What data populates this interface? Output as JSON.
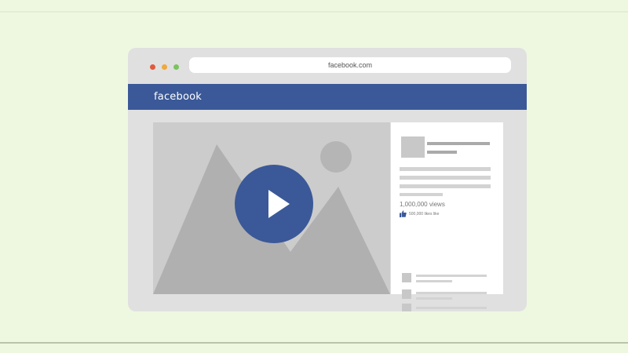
{
  "browser": {
    "address": "facebook.com"
  },
  "header": {
    "logo": "facebook"
  },
  "video": {
    "play_icon": "play-icon"
  },
  "sidebar": {
    "views": "1,000,000 views",
    "likes": "500,000 likes like"
  },
  "colors": {
    "page_background": "#eef8e0",
    "browser_frame": "#e0e0e0",
    "facebook_blue": "#3b5998",
    "placeholder_gray": "#cccccc",
    "dot_red": "#e05a3e",
    "dot_yellow": "#f1a83b",
    "dot_green": "#7cc35e"
  }
}
